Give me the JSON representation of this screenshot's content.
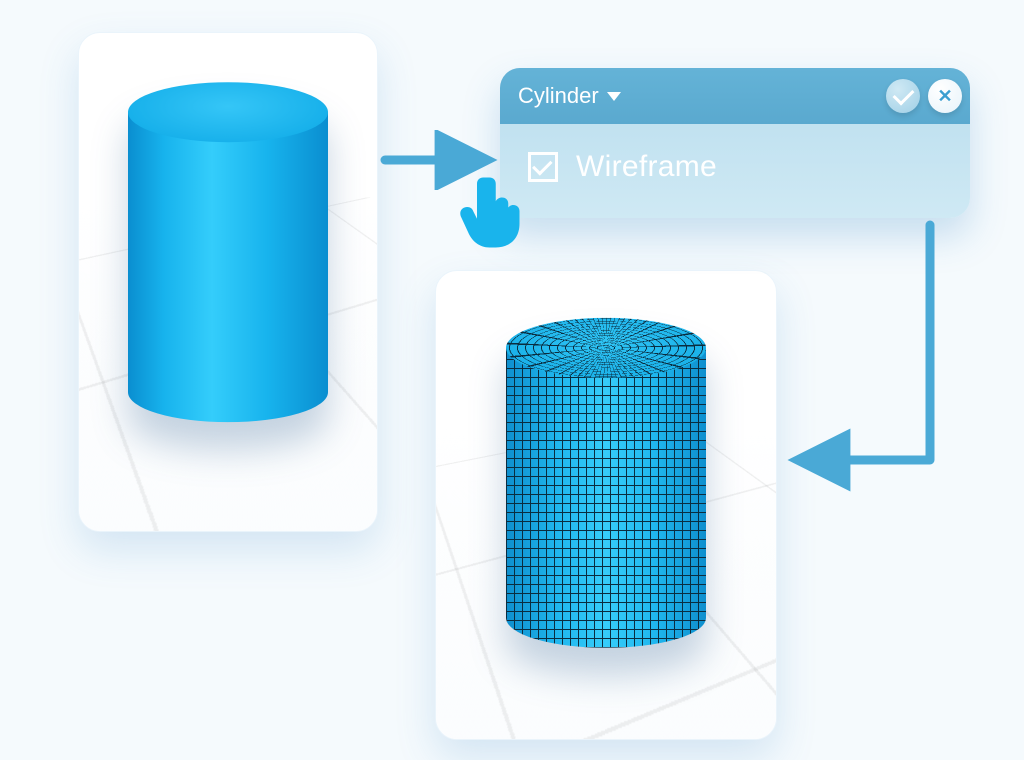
{
  "panels": {
    "before": {
      "object": "Cylinder (solid shaded)"
    },
    "after": {
      "object": "Cylinder (wireframe)"
    }
  },
  "popup": {
    "title": "Cylinder",
    "option_label": "Wireframe",
    "option_checked": true
  },
  "icons": {
    "dropdown": "chevron-down-icon",
    "confirm": "check-icon",
    "close": "close-icon",
    "cursor": "pointer-hand-icon"
  },
  "colors": {
    "accent": "#19b4ec",
    "popup_header": "#5fb0d3",
    "popup_body": "#c5e4f1",
    "arrow": "#4aa9d6"
  }
}
